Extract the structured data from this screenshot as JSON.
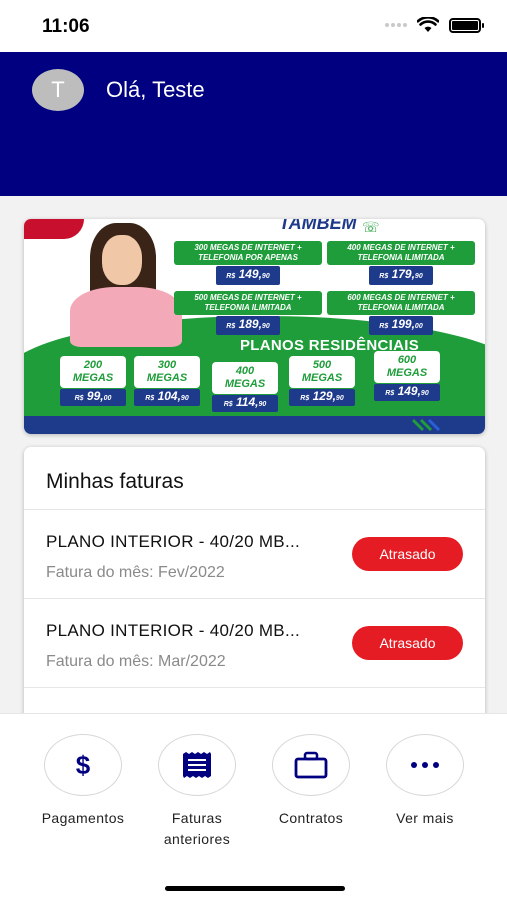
{
  "status_bar": {
    "time": "11:06"
  },
  "header": {
    "avatar_initial": "T",
    "greeting": "Olá, Teste"
  },
  "banner": {
    "headline": "TAMBÉM",
    "combos": [
      {
        "label": "300 MEGAS DE INTERNET + TELEFONIA POR APENAS",
        "currency": "R$",
        "price": "149,",
        "cents": "90"
      },
      {
        "label": "400 MEGAS DE INTERNET + TELEFONIA ILIMITADA",
        "currency": "R$",
        "price": "179,",
        "cents": "90"
      },
      {
        "label": "500 MEGAS DE INTERNET + TELEFONIA ILIMITADA",
        "currency": "R$",
        "price": "189,",
        "cents": "90"
      },
      {
        "label": "600 MEGAS DE INTERNET + TELEFONIA ILIMITADA",
        "currency": "R$",
        "price": "199,",
        "cents": "00"
      }
    ],
    "planos_title": "PLANOS RESIDÊNCIAIS",
    "plans": [
      {
        "megas": "200",
        "unit": "MEGAS",
        "currency": "R$",
        "price": "99,",
        "cents": "00"
      },
      {
        "megas": "300",
        "unit": "MEGAS",
        "currency": "R$",
        "price": "104,",
        "cents": "90"
      },
      {
        "megas": "400",
        "unit": "MEGAS",
        "currency": "R$",
        "price": "114,",
        "cents": "90"
      },
      {
        "megas": "500",
        "unit": "MEGAS",
        "currency": "R$",
        "price": "129,",
        "cents": "90"
      },
      {
        "megas": "600",
        "unit": "MEGAS",
        "currency": "R$",
        "price": "149,",
        "cents": "90"
      }
    ]
  },
  "faturas": {
    "title": "Minhas faturas",
    "items": [
      {
        "plan": "PLANO INTERIOR - 40/20 MB...",
        "month": "Fatura do mês: Fev/2022",
        "status": "Atrasado"
      },
      {
        "plan": "PLANO INTERIOR - 40/20 MB...",
        "month": "Fatura do mês: Mar/2022",
        "status": "Atrasado"
      }
    ]
  },
  "bottom_nav": {
    "items": [
      {
        "label": "Pagamentos",
        "icon": "dollar-icon"
      },
      {
        "label": "Faturas anteriores",
        "icon": "receipt-icon"
      },
      {
        "label": "Contratos",
        "icon": "briefcase-icon"
      },
      {
        "label": "Ver mais",
        "icon": "more-icon"
      }
    ]
  },
  "colors": {
    "header": "#000080",
    "badge": "#e51c23",
    "banner_green": "#1f9d3a",
    "banner_blue": "#1e3a8a"
  }
}
